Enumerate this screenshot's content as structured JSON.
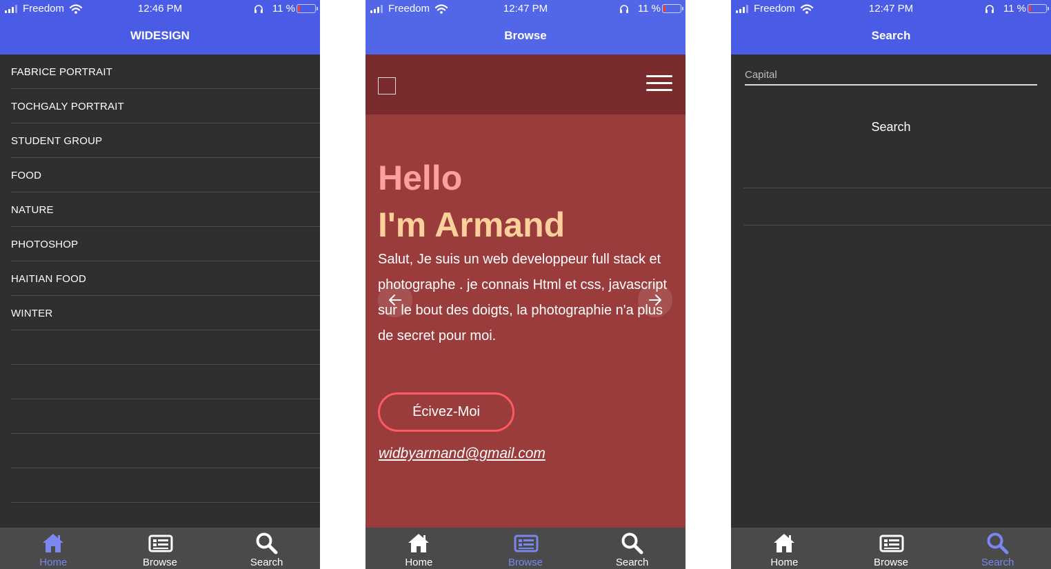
{
  "status": {
    "carrier": "Freedom",
    "battery_text": "11 %",
    "times": [
      "12:46 PM",
      "12:47 PM",
      "12:47 PM"
    ]
  },
  "screens": [
    {
      "title": "WIDESIGN",
      "items": [
        {
          "label": "FABRICE PORTRAIT"
        },
        {
          "label": "TOCHGALY PORTRAIT"
        },
        {
          "label": "STUDENT GROUP"
        },
        {
          "label": "FOOD"
        },
        {
          "label": "NATURE"
        },
        {
          "label": "PHOTOSHOP"
        },
        {
          "label": "HAITIAN FOOD"
        },
        {
          "label": "WINTER"
        }
      ]
    },
    {
      "title": "Browse",
      "hero": {
        "hello": "Hello",
        "name": "I'm Armand",
        "bio": "Salut, Je suis un web developpeur full stack et photographe . je connais Html et css, javascript sur le bout des doigts, la photographie n'a plus de secret pour moi.",
        "cta": "Écivez-Moi",
        "email": "widbyarmand@gmail.com"
      }
    },
    {
      "title": "Search",
      "field_placeholder": "Capital",
      "button": "Search"
    }
  ],
  "tabs": {
    "home": "Home",
    "browse": "Browse",
    "search": "Search"
  },
  "colors": {
    "nav": "#4a5be6",
    "active_tab": "#7b86ee",
    "hero_bg": "#9a3b3c",
    "hello": "#ffa0a0",
    "name": "#ffd09b",
    "cta_border": "#ff5a5f"
  },
  "icons": [
    "signal-icon",
    "wifi-icon",
    "headphones-icon",
    "battery-icon",
    "home-icon",
    "browse-icon",
    "search-icon",
    "menu-icon",
    "arrow-left-icon",
    "arrow-right-icon"
  ]
}
